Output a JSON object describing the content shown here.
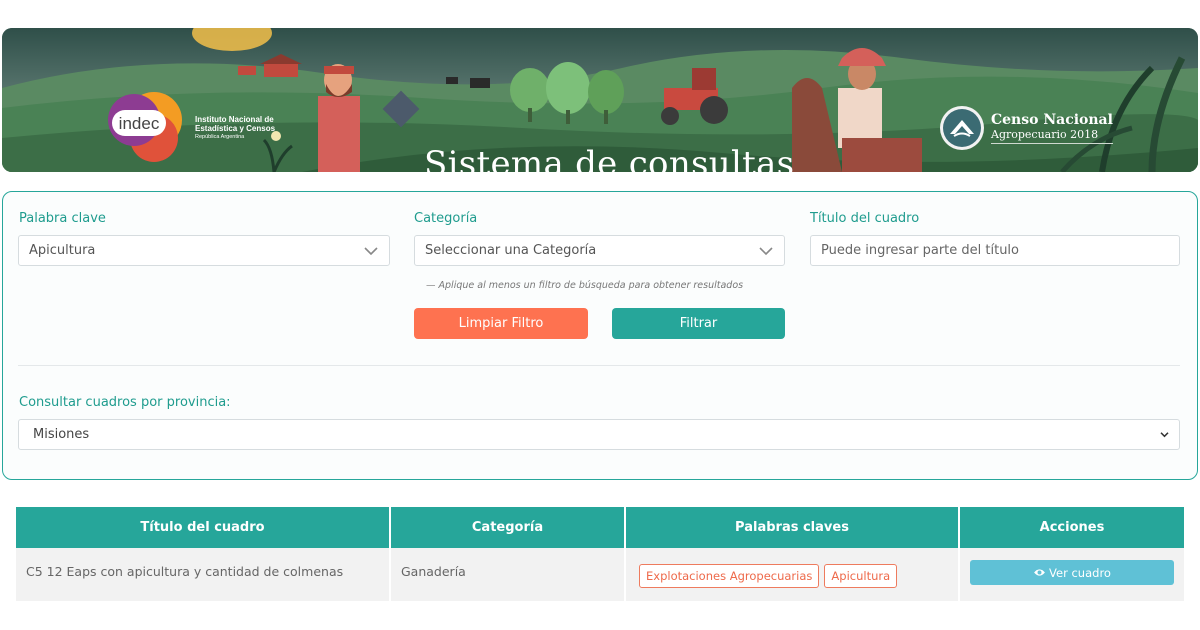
{
  "banner": {
    "title": "Sistema de consultas",
    "indec": {
      "logo_text": "indec",
      "line1": "Instituto Nacional de",
      "line2": "Estadística y Censos",
      "line3": "República Argentina"
    },
    "censo": {
      "line1": "Censo Nacional",
      "line2": "Agropecuario 2018"
    }
  },
  "filters": {
    "keyword": {
      "label": "Palabra clave",
      "value": "Apicultura"
    },
    "category": {
      "label": "Categoría",
      "value": "Seleccionar una Categoría"
    },
    "title_field": {
      "label": "Título del cuadro",
      "placeholder": "Puede ingresar parte del título"
    },
    "hint": "—  Aplique al menos un filtro de búsqueda para obtener resultados",
    "clear_button": "Limpiar Filtro",
    "filter_button": "Filtrar",
    "province": {
      "label": "Consultar cuadros por provincia:",
      "value": "Misiones"
    }
  },
  "colors": {
    "accent": "#26a69a",
    "clear_button": "#fe7250",
    "view_button": "#5fc1d6",
    "tag": "#ee6a4b"
  },
  "table": {
    "headers": [
      "Título del cuadro",
      "Categoría",
      "Palabras claves",
      "Acciones"
    ],
    "rows": [
      {
        "title": "C5 12 Eaps con apicultura y cantidad de colmenas",
        "category": "Ganadería",
        "tags": [
          "Explotaciones Agropecuarias",
          "Apicultura"
        ],
        "action": "Ver cuadro",
        "action_icon": "eye-icon"
      }
    ]
  }
}
